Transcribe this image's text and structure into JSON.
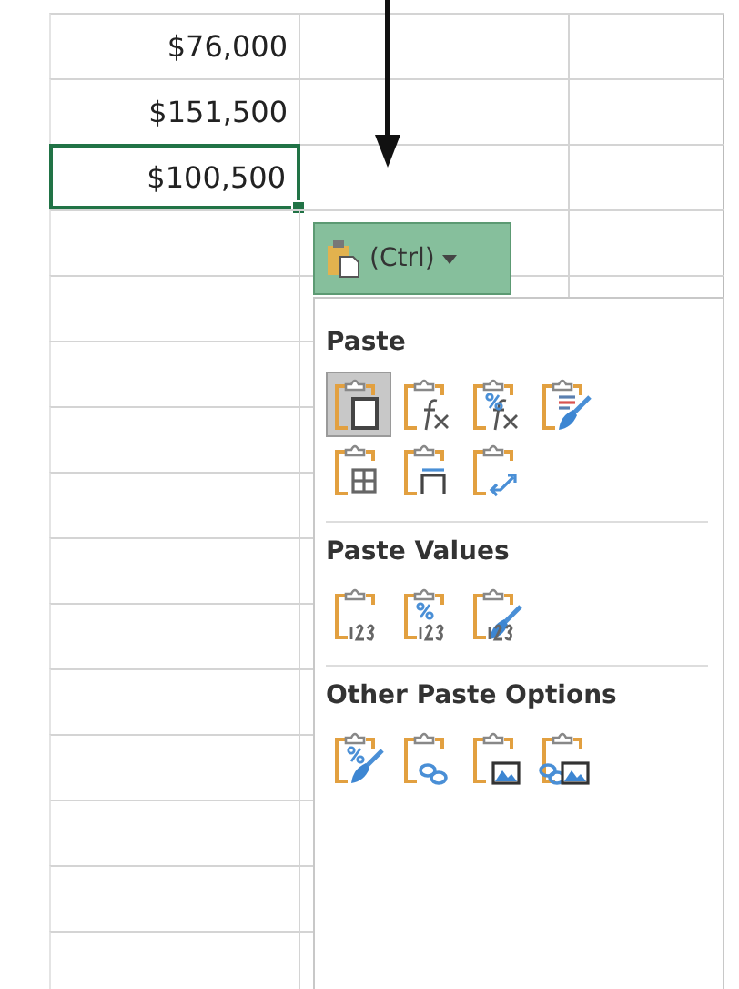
{
  "cells": [
    {
      "value": "$76,000",
      "selected": false
    },
    {
      "value": "$151,500",
      "selected": false
    },
    {
      "value": "$100,500",
      "selected": true
    }
  ],
  "paste_button": {
    "label": "(Ctrl)"
  },
  "menu": {
    "sections": [
      {
        "heading": "Paste",
        "options": [
          {
            "kind": "paste",
            "selected": true
          },
          {
            "kind": "formulas",
            "selected": false
          },
          {
            "kind": "formulas-number-format",
            "selected": false
          },
          {
            "kind": "keep-source-format",
            "selected": false
          },
          {
            "kind": "no-borders",
            "selected": false
          },
          {
            "kind": "column-widths",
            "selected": false
          },
          {
            "kind": "transpose",
            "selected": false
          }
        ]
      },
      {
        "heading": "Paste Values",
        "options": [
          {
            "kind": "values",
            "selected": false
          },
          {
            "kind": "values-number-format",
            "selected": false
          },
          {
            "kind": "values-source-format",
            "selected": false
          }
        ]
      },
      {
        "heading": "Other Paste Options",
        "options": [
          {
            "kind": "formatting",
            "selected": false
          },
          {
            "kind": "link",
            "selected": false
          },
          {
            "kind": "picture",
            "selected": false
          },
          {
            "kind": "linked-picture",
            "selected": false
          }
        ]
      }
    ]
  }
}
